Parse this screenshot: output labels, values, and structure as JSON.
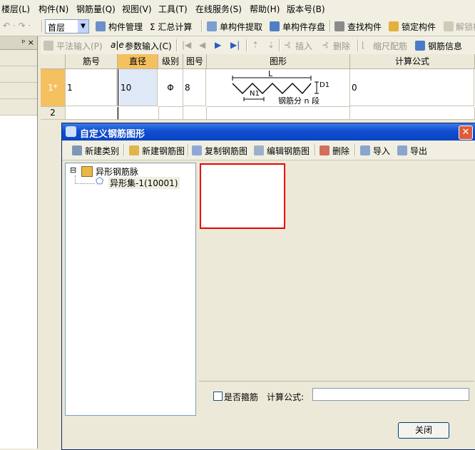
{
  "menu": {
    "items": [
      "楼层(L)",
      "构件(N)",
      "钢筋量(Q)",
      "视图(V)",
      "工具(T)",
      "在线服务(S)",
      "帮助(H)",
      "版本号(B)"
    ]
  },
  "toolbar1": {
    "floor_value": "首层",
    "items": [
      "构件管理",
      "Σ 汇总计算",
      "单构件提取",
      "单构件存盘",
      "查找构件",
      "锁定构件",
      "解锁构"
    ]
  },
  "panel": {
    "pin": "ᵖ ×"
  },
  "toolbar2": {
    "items": [
      "平法输入(P)",
      "参数输入(C)",
      "插入",
      "删除",
      "缩尺配筋",
      "钢筋信息"
    ]
  },
  "grid": {
    "headers": [
      "筋号",
      "直径(mm)",
      "级别",
      "图号",
      "图形",
      "计算公式"
    ],
    "rows": [
      {
        "num": "1*",
        "jinhao": "1",
        "diameter": "10",
        "level": "Φ",
        "tuhao": "8",
        "formula": "0"
      },
      {
        "num": "2",
        "jinhao": "",
        "diameter": "",
        "level": "",
        "tuhao": "",
        "formula": ""
      }
    ],
    "shape": {
      "L": "L",
      "N1": "N1",
      "D1": "D1",
      "caption": "钢筋分 n 段"
    }
  },
  "dialog": {
    "title": "自定义钢筋图形",
    "close_glyph": "✕",
    "toolbar": [
      "新建类别",
      "新建钢筋图",
      "复制钢筋图",
      "编辑钢筋图",
      "删除",
      "导入",
      "导出"
    ],
    "tree": {
      "root": "异形钢筋脉",
      "child": "异形集-1(10001)",
      "expander": "⊟"
    },
    "checkbox_label": "是否箍筋",
    "formula_label": "计算公式:",
    "formula_value": "",
    "close_button": "关闭"
  },
  "colors": {
    "title_bar": "#0f4fd1",
    "highlight": "#e00000",
    "row_header_selected": "#f5c060"
  }
}
